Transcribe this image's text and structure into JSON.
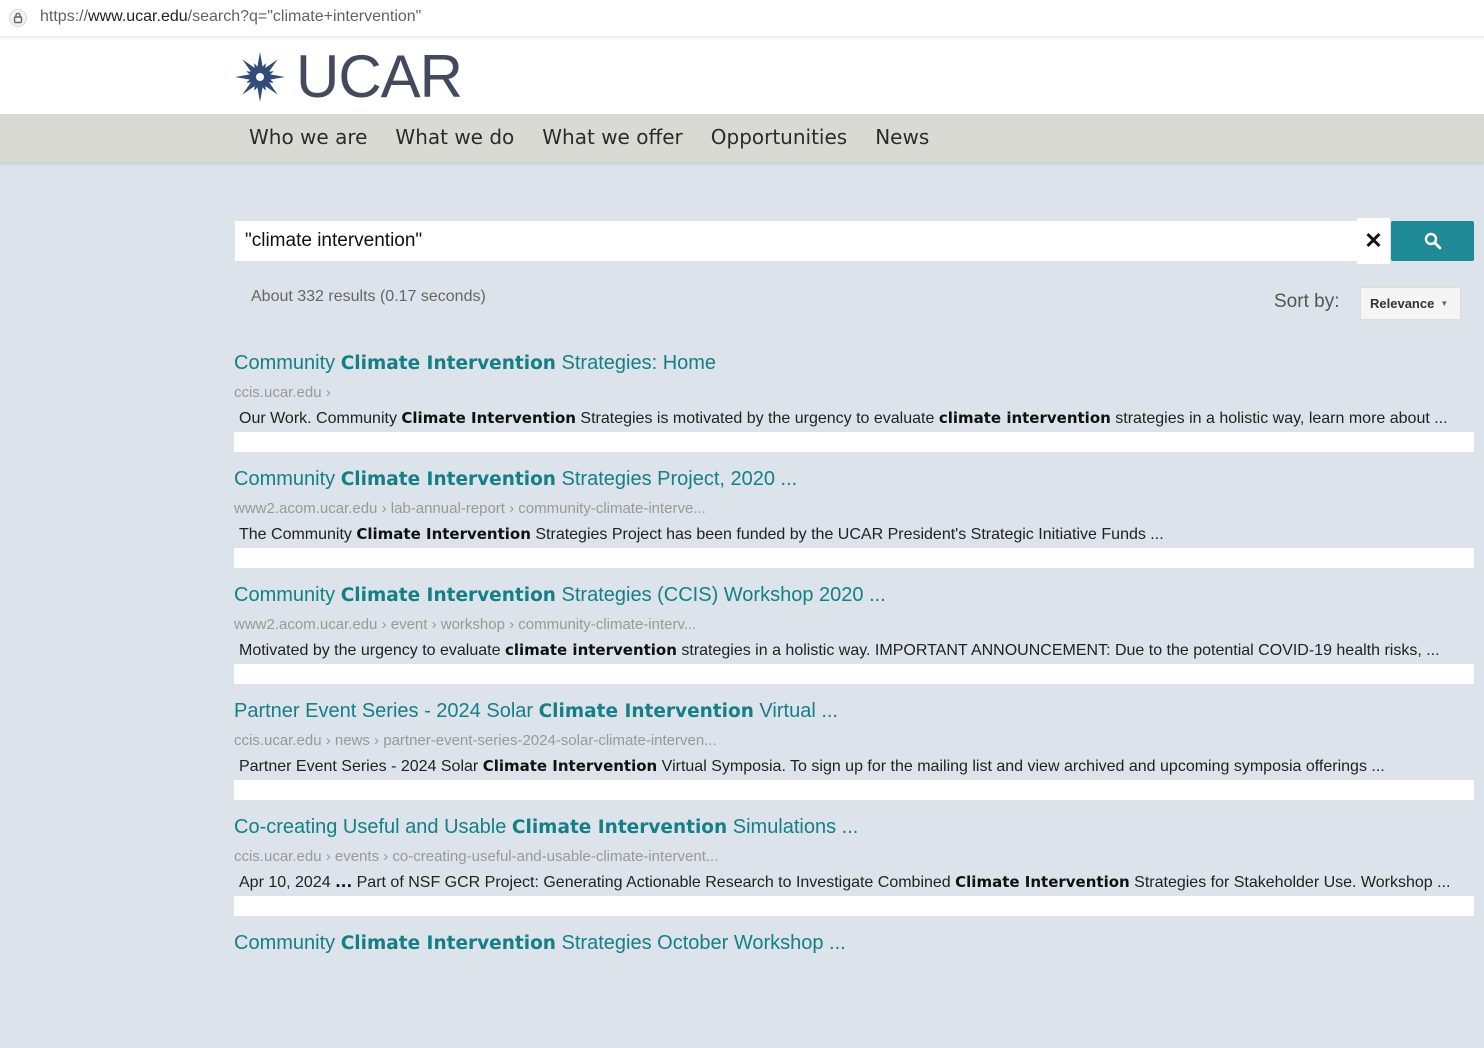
{
  "browser": {
    "url_prefix": "https://",
    "url_domain": "www.ucar.edu",
    "url_rest": "/search?q=\"climate+intervention\""
  },
  "header": {
    "logo_text": "UCAR",
    "logo_icon": "ucar-star-icon",
    "brand_color": "#2f4d78"
  },
  "nav": {
    "items": [
      "Who we are",
      "What we do",
      "What we offer",
      "Opportunities",
      "News"
    ]
  },
  "search": {
    "query": "\"climate intervention\"",
    "clear_icon": "close-icon",
    "submit_icon": "search-icon",
    "accent_color": "#1d8a96"
  },
  "summary": {
    "result_count": "About 332 results (0.17 seconds)",
    "sort_label": "Sort by:",
    "sort_value": "Relevance"
  },
  "results": [
    {
      "title": [
        [
          "Community ",
          false
        ],
        [
          "Climate Intervention",
          true
        ],
        [
          " Strategies: Home",
          false
        ]
      ],
      "url": "ccis.ucar.edu ›",
      "snippet": [
        [
          "Our Work. Community ",
          false
        ],
        [
          "Climate Intervention",
          true
        ],
        [
          " Strategies is motivated by the urgency to evaluate ",
          false
        ],
        [
          "climate intervention",
          true
        ],
        [
          " strategies in a holistic way, learn more about ...",
          false
        ]
      ]
    },
    {
      "title": [
        [
          "Community ",
          false
        ],
        [
          "Climate Intervention",
          true
        ],
        [
          " Strategies Project, 2020 ...",
          false
        ]
      ],
      "url": "www2.acom.ucar.edu › lab-annual-report › community-climate-interve...",
      "snippet": [
        [
          "The Community ",
          false
        ],
        [
          "Climate Intervention",
          true
        ],
        [
          " Strategies Project has been funded by the UCAR President's Strategic Initiative Funds ...",
          false
        ]
      ]
    },
    {
      "title": [
        [
          "Community ",
          false
        ],
        [
          "Climate Intervention",
          true
        ],
        [
          " Strategies (CCIS) Workshop 2020 ...",
          false
        ]
      ],
      "url": "www2.acom.ucar.edu › event › workshop › community-climate-interv...",
      "snippet": [
        [
          "Motivated by the urgency to evaluate ",
          false
        ],
        [
          "climate intervention",
          true
        ],
        [
          " strategies in a holistic way. IMPORTANT ANNOUNCEMENT: Due to the potential COVID-19 health risks, ...",
          false
        ]
      ]
    },
    {
      "title": [
        [
          "Partner Event Series - 2024 Solar ",
          false
        ],
        [
          "Climate Intervention",
          true
        ],
        [
          " Virtual ...",
          false
        ]
      ],
      "url": "ccis.ucar.edu › news › partner-event-series-2024-solar-climate-interven...",
      "snippet": [
        [
          "Partner Event Series - 2024 Solar ",
          false
        ],
        [
          "Climate Intervention",
          true
        ],
        [
          " Virtual Symposia. To sign up for the mailing list and view archived and upcoming symposia offerings ...",
          false
        ]
      ]
    },
    {
      "title": [
        [
          "Co-creating Useful and Usable ",
          false
        ],
        [
          "Climate Intervention",
          true
        ],
        [
          " Simulations ...",
          false
        ]
      ],
      "url": "ccis.ucar.edu › events › co-creating-useful-and-usable-climate-intervent...",
      "snippet": [
        [
          "Apr 10, 2024 ",
          false
        ],
        [
          "...",
          true
        ],
        [
          " Part of NSF GCR Project: Generating Actionable Research to Investigate Combined ",
          false
        ],
        [
          "Climate Intervention",
          true
        ],
        [
          " Strategies for Stakeholder Use. Workshop ...",
          false
        ]
      ]
    },
    {
      "title": [
        [
          "Community ",
          false
        ],
        [
          "Climate Intervention",
          true
        ],
        [
          " Strategies October Workshop ...",
          false
        ]
      ],
      "url": "",
      "snippet": []
    }
  ]
}
